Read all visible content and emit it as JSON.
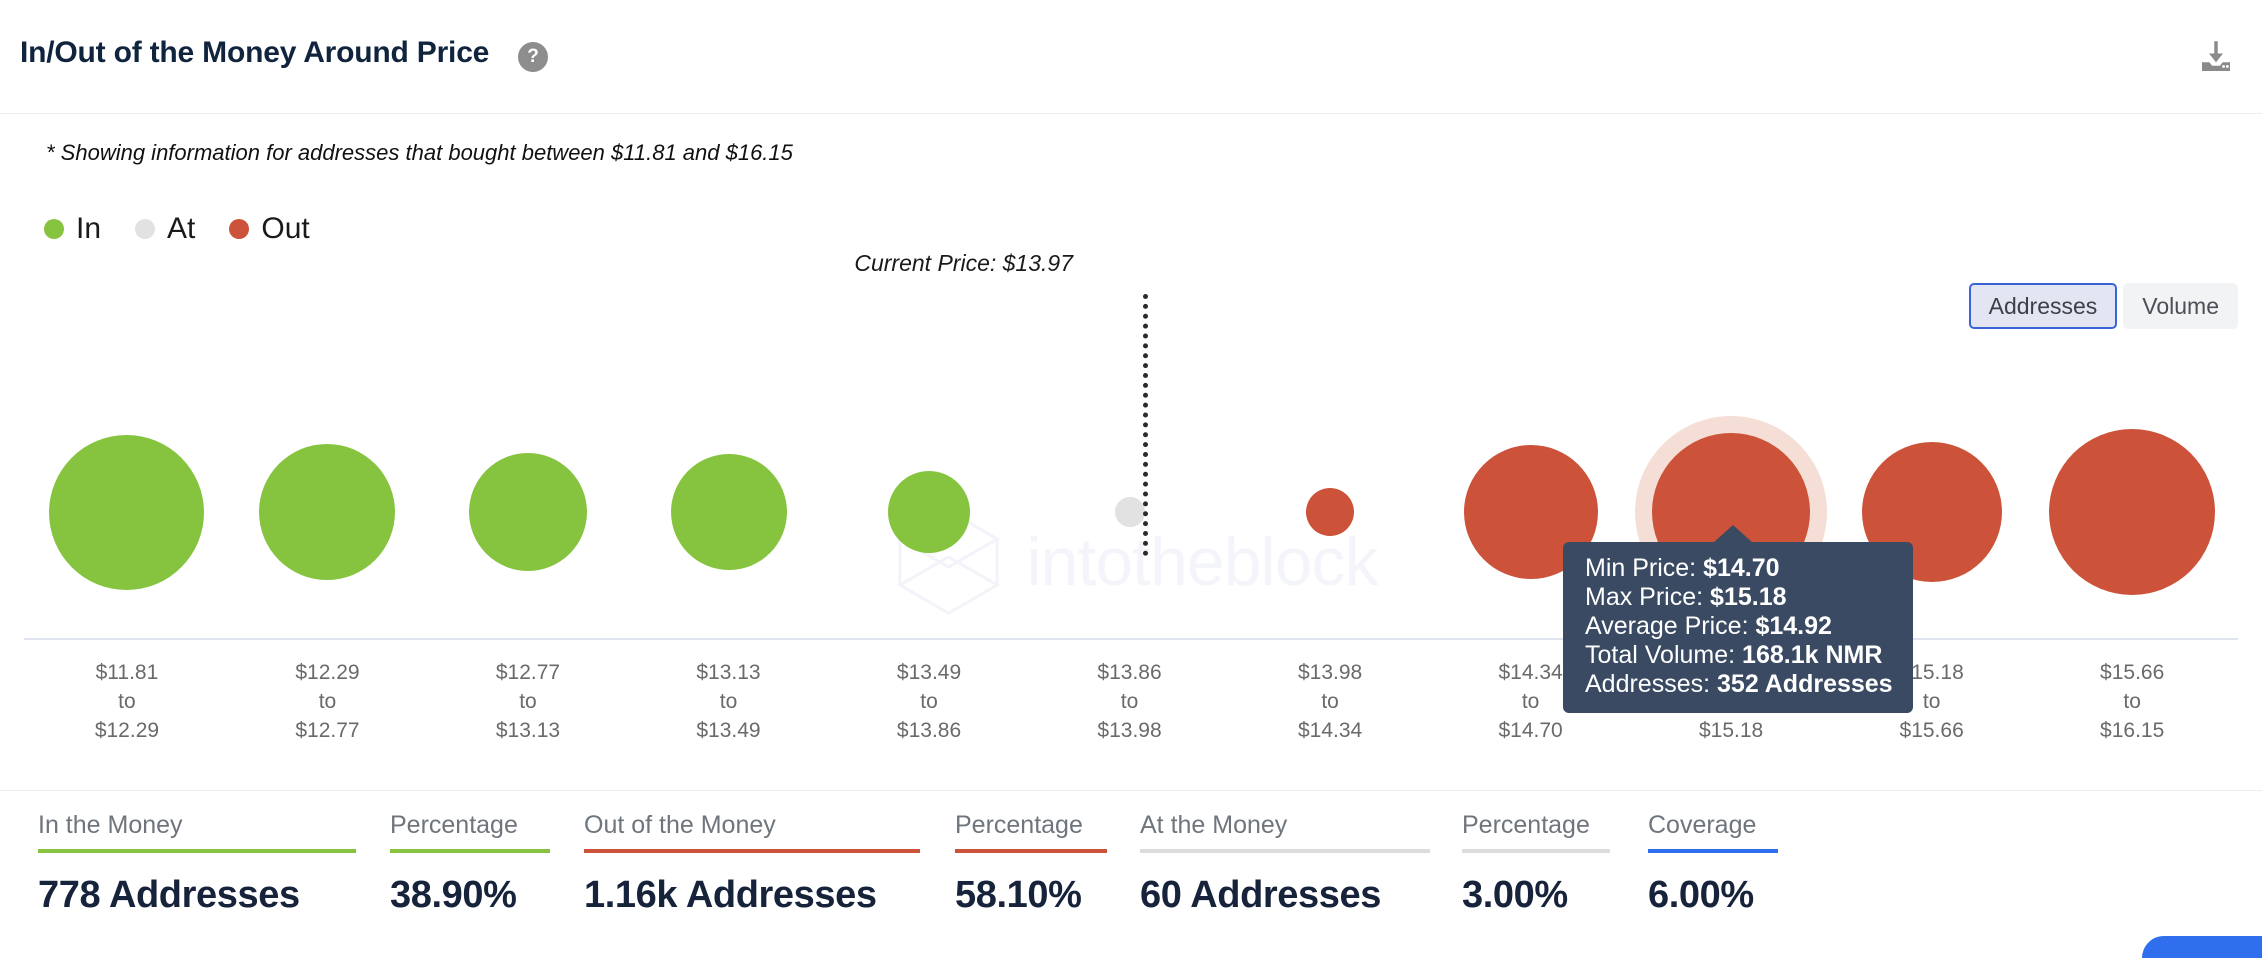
{
  "header": {
    "title": "In/Out of the Money Around Price",
    "help_icon": "question-mark-circle-icon",
    "download_icon": "download-icon"
  },
  "subtitle": "* Showing information for addresses that bought between $11.81 and $16.15",
  "legend": [
    {
      "label": "In",
      "color": "#86c440"
    },
    {
      "label": "At",
      "color": "#e2e2e2"
    },
    {
      "label": "Out",
      "color": "#cc5339"
    }
  ],
  "toggle": {
    "options": [
      "Addresses",
      "Volume"
    ],
    "selected": "Addresses",
    "addresses_label": "Addresses",
    "volume_label": "Volume"
  },
  "current_price": {
    "label": "Current Price: $13.97",
    "value": 13.97
  },
  "watermark": "intotheblock",
  "tooltip": {
    "min_price_label": "Min Price:",
    "min_price_value": "$14.70",
    "max_price_label": "Max Price:",
    "max_price_value": "$15.18",
    "average_price_label": "Average Price:",
    "average_price_value": "$14.92",
    "total_volume_label": "Total Volume:",
    "total_volume_value": "168.1k NMR",
    "addresses_label": "Addresses:",
    "addresses_value": "352 Addresses"
  },
  "stats": [
    {
      "label": "In the Money",
      "value": "778 Addresses",
      "rule_color": "#86c440"
    },
    {
      "label": "Percentage",
      "value": "38.90%",
      "rule_color": "#86c440"
    },
    {
      "label": "Out of the Money",
      "value": "1.16k Addresses",
      "rule_color": "#cc5339"
    },
    {
      "label": "Percentage",
      "value": "58.10%",
      "rule_color": "#cc5339"
    },
    {
      "label": "At the Money",
      "value": "60 Addresses",
      "rule_color": "#dcdcdc"
    },
    {
      "label": "Percentage",
      "value": "3.00%",
      "rule_color": "#dcdcdc"
    },
    {
      "label": "Coverage",
      "value": "6.00%",
      "rule_color": "#2f6fed"
    }
  ],
  "chart_data": {
    "type": "scatter",
    "title": "In/Out of the Money Around Price",
    "xlabel": "",
    "ylabel": "",
    "metric": "Addresses",
    "legend_position": "top-left",
    "grid": false,
    "current_price": 13.97,
    "price_range": {
      "min": 11.81,
      "max": 16.15
    },
    "categories": [
      "$11.81\nto\n$12.29",
      "$12.29\nto\n$12.77",
      "$12.77\nto\n$13.13",
      "$13.13\nto\n$13.49",
      "$13.49\nto\n$13.86",
      "$13.86\nto\n$13.98",
      "$13.98\nto\n$14.34",
      "$14.34\nto\n$14.70",
      "$14.70\nto\n$15.18",
      "$15.18\nto\n$15.66",
      "$15.66\nto\n$16.15"
    ],
    "bubbles": [
      {
        "min": "$11.81",
        "max": "$12.29",
        "status": "In",
        "size": 155,
        "color": "#86c440"
      },
      {
        "min": "$12.29",
        "max": "$12.77",
        "status": "In",
        "size": 136,
        "color": "#86c440"
      },
      {
        "min": "$12.77",
        "max": "$13.13",
        "status": "In",
        "size": 118,
        "color": "#86c440"
      },
      {
        "min": "$13.13",
        "max": "$13.49",
        "status": "In",
        "size": 116,
        "color": "#86c440"
      },
      {
        "min": "$13.49",
        "max": "$13.86",
        "status": "In",
        "size": 82,
        "color": "#86c440"
      },
      {
        "min": "$13.86",
        "max": "$13.98",
        "status": "At",
        "size": 30,
        "color": "#e2e2e2"
      },
      {
        "min": "$13.98",
        "max": "$14.34",
        "status": "Out",
        "size": 48,
        "color": "#cc5339"
      },
      {
        "min": "$14.34",
        "max": "$14.70",
        "status": "Out",
        "size": 134,
        "color": "#cc5339"
      },
      {
        "min": "$14.70",
        "max": "$15.18",
        "status": "Out",
        "size": 158,
        "color": "#cc5339",
        "highlighted": true
      },
      {
        "min": "$15.18",
        "max": "$15.66",
        "status": "Out",
        "size": 140,
        "color": "#cc5339"
      },
      {
        "min": "$15.66",
        "max": "$16.15",
        "status": "Out",
        "size": 166,
        "color": "#cc5339"
      }
    ]
  }
}
